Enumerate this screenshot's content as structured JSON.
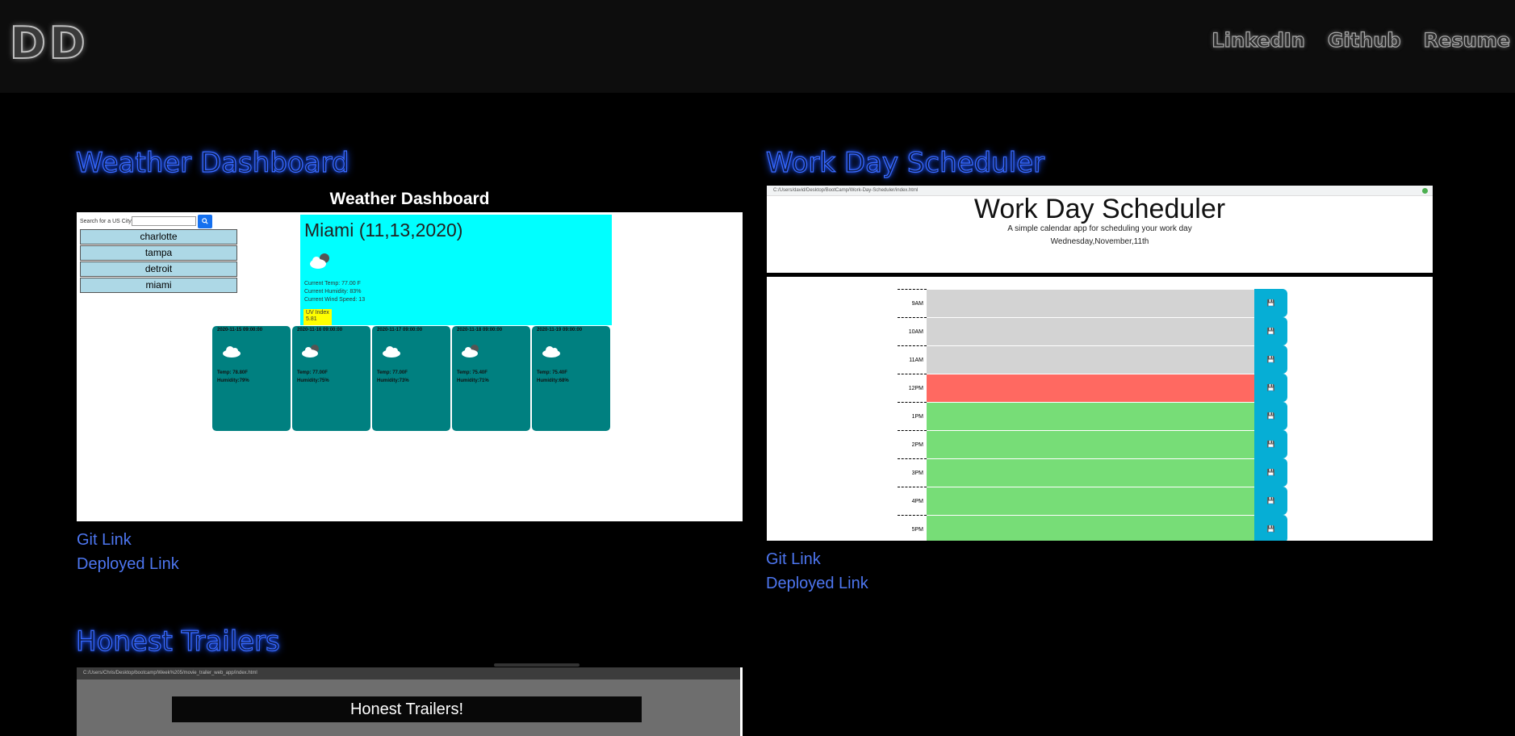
{
  "header": {
    "logo": "DD",
    "nav": [
      "LinkedIn",
      "Github",
      "Resume"
    ]
  },
  "projects": {
    "weather": {
      "title": "Weather Dashboard",
      "git_link": "Git Link",
      "deployed_link": "Deployed Link",
      "app": {
        "heading": "Weather Dashboard",
        "search_label": "Search for a US City:",
        "search_icon": "search-icon",
        "cities": [
          "charlotte",
          "tampa",
          "detroit",
          "miami"
        ],
        "current": {
          "title": "Miami (11,13,2020)",
          "temp": "Current Temp: 77.00 F",
          "humidity": "Current Humidity: 83%",
          "wind": "Current Wind Speed: 13",
          "uv_label": "UV Index",
          "uv_value": "5.81"
        },
        "forecast": [
          {
            "date": "2020-11-15 09:00:00",
            "temp": "Temp: 78.80F",
            "humidity": "Humidity:79%"
          },
          {
            "date": "2020-11-16 09:00:00",
            "temp": "Temp: 77.00F",
            "humidity": "Humidity:75%"
          },
          {
            "date": "2020-11-17 09:00:00",
            "temp": "Temp: 77.00F",
            "humidity": "Humidity:73%"
          },
          {
            "date": "2020-11-18 09:00:00",
            "temp": "Temp: 75.40F",
            "humidity": "Humidity:71%"
          },
          {
            "date": "2020-11-19 09:00:00",
            "temp": "Temp: 75.40F",
            "humidity": "Humidity:68%"
          }
        ]
      }
    },
    "scheduler": {
      "title": "Work Day Scheduler",
      "git_link": "Git Link",
      "deployed_link": "Deployed Link",
      "app": {
        "url": "C:/Users/david/Desktop/BootCamp/Work-Day-Scheduler/index.html",
        "heading": "Work Day Scheduler",
        "subtitle": "A simple calendar app for scheduling your work day",
        "date": "Wednesday,November,11th",
        "hours": [
          {
            "label": "9AM",
            "state": "past"
          },
          {
            "label": "10AM",
            "state": "past"
          },
          {
            "label": "11AM",
            "state": "past"
          },
          {
            "label": "12PM",
            "state": "present"
          },
          {
            "label": "1PM",
            "state": "future"
          },
          {
            "label": "2PM",
            "state": "future"
          },
          {
            "label": "3PM",
            "state": "future"
          },
          {
            "label": "4PM",
            "state": "future"
          },
          {
            "label": "5PM",
            "state": "future"
          }
        ]
      }
    },
    "trailers": {
      "title": "Honest Trailers",
      "app": {
        "url": "C:/Users/Chris/Desktop/bootcamp/Week%205/movie_trailer_web_app/index.html",
        "heading": "Honest Trailers!"
      }
    }
  },
  "colors": {
    "accent_blue": "#3a6bff",
    "link_blue": "#4d76f0",
    "cyan": "#00ffff",
    "teal": "#008080",
    "past": "#d3d3d3",
    "present": "#ff6961",
    "future": "#77dd77",
    "save": "#06aed5"
  }
}
